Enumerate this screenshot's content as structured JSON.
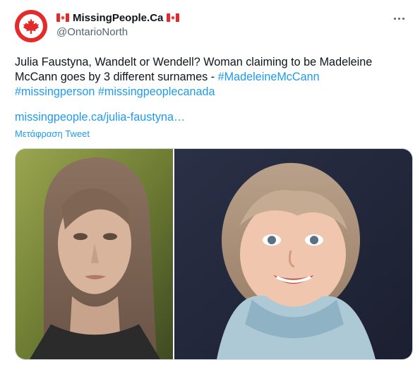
{
  "account": {
    "display_name": "MissingPeople.Ca",
    "handle": "@OntarioNorth"
  },
  "tweet": {
    "text_plain": "Julia Faustyna, Wandelt or Wendell? Woman claiming to be Madeleine McCann goes by 3 different surnames - ",
    "hashtags": [
      "#MadeleineMcCann",
      "#missingperson",
      "#missingpeoplecanada"
    ],
    "link": "missingpeople.ca/julia-faustyna…",
    "translate_label": "Μετάφραση Tweet"
  },
  "colors": {
    "accent": "#1d9bf0",
    "text": "#0f1419",
    "secondary": "#536471",
    "canada_red": "#e32b2b"
  },
  "icons": {
    "avatar": "maple-leaf-icon",
    "flag": "canada-flag-icon",
    "menu": "more-options-icon"
  }
}
